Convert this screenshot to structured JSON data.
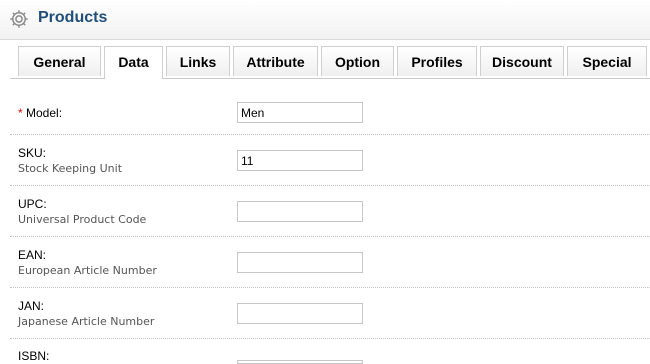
{
  "header": {
    "title": "Products",
    "icon": "gear-icon"
  },
  "tabs": [
    {
      "label": "General"
    },
    {
      "label": "Data"
    },
    {
      "label": "Links"
    },
    {
      "label": "Attribute"
    },
    {
      "label": "Option"
    },
    {
      "label": "Profiles"
    },
    {
      "label": "Discount"
    },
    {
      "label": "Special"
    }
  ],
  "active_tab": "Data",
  "form": {
    "model": {
      "label": "Model:",
      "required_mark": "*",
      "value": "Men"
    },
    "sku": {
      "label": "SKU:",
      "help": "Stock Keeping Unit",
      "value": "11"
    },
    "upc": {
      "label": "UPC:",
      "help": "Universal Product Code",
      "value": ""
    },
    "ean": {
      "label": "EAN:",
      "help": "European Article Number",
      "value": ""
    },
    "jan": {
      "label": "JAN:",
      "help": "Japanese Article Number",
      "value": ""
    },
    "isbn": {
      "label": "ISBN:",
      "value": ""
    }
  },
  "colors": {
    "title": "#1f4f7c",
    "required": "#e00000"
  }
}
